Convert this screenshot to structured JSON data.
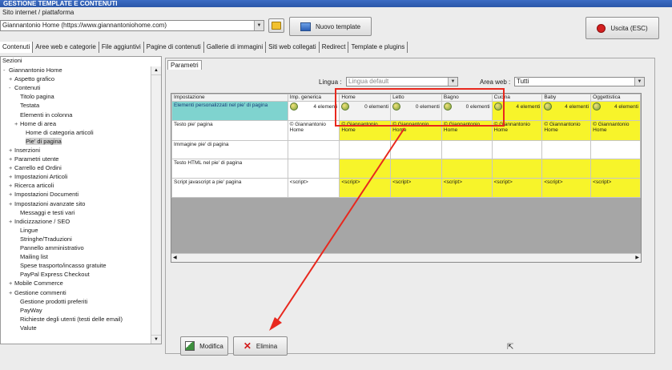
{
  "window": {
    "title": "GESTIONE TEMPLATE E CONTENUTI"
  },
  "site": {
    "label": "Sito internet / piattaforma",
    "selected": "Giannantonio Home (https://www.giannantoniohome.com)"
  },
  "buttons": {
    "new_template": "Nuovo template",
    "exit": "Uscita (ESC)",
    "modify": "Modifica",
    "delete": "Elimina"
  },
  "tabs": [
    "Contenuti",
    "Aree web e categorie",
    "File aggiuntivi",
    "Pagine di contenuti",
    "Gallerie di immagini",
    "Siti web collegati",
    "Redirect",
    "Template e plugins"
  ],
  "tree": {
    "header": "Sezioni",
    "items": [
      {
        "label": "Giannantonio Home",
        "exp": "-"
      },
      {
        "label": "Aspetto grafico",
        "exp": "+"
      },
      {
        "label": "Contenuti",
        "exp": "-"
      },
      {
        "label": "Titolo pagina",
        "exp": ""
      },
      {
        "label": "Testata",
        "exp": ""
      },
      {
        "label": "Elementi in colonna",
        "exp": ""
      },
      {
        "label": "Home di area",
        "exp": "+"
      },
      {
        "label": "Home di categoria articoli",
        "exp": ""
      },
      {
        "label": "Pie' di pagina",
        "exp": ""
      },
      {
        "label": "Inserzioni",
        "exp": "+"
      },
      {
        "label": "Parametri utente",
        "exp": "+"
      },
      {
        "label": "Carrello ed Ordini",
        "exp": "+"
      },
      {
        "label": "Impostazioni Articoli",
        "exp": "+"
      },
      {
        "label": "Ricerca articoli",
        "exp": "+"
      },
      {
        "label": "Impostazioni Documenti",
        "exp": "+"
      },
      {
        "label": "Impostazioni avanzate sito",
        "exp": "+"
      },
      {
        "label": "Messaggi e testi vari",
        "exp": ""
      },
      {
        "label": "Indicizzazione / SEO",
        "exp": "+"
      },
      {
        "label": "Lingue",
        "exp": ""
      },
      {
        "label": "Stringhe/Traduzioni",
        "exp": ""
      },
      {
        "label": "Pannello amministrativo",
        "exp": ""
      },
      {
        "label": "Mailing list",
        "exp": ""
      },
      {
        "label": "Spese trasporto/incasso gratuite",
        "exp": ""
      },
      {
        "label": "PayPal Express Checkout",
        "exp": ""
      },
      {
        "label": "Mobile Commerce",
        "exp": "+"
      },
      {
        "label": "Gestione commenti",
        "exp": "+"
      },
      {
        "label": "Gestione prodotti preferiti",
        "exp": ""
      },
      {
        "label": "PayWay",
        "exp": ""
      },
      {
        "label": "Richieste degli utenti (testi delle email)",
        "exp": ""
      },
      {
        "label": "Valute",
        "exp": ""
      }
    ]
  },
  "params": {
    "tab": "Parametri",
    "lingua_label": "Lingua :",
    "lingua_value": "Lingua default",
    "area_label": "Area web :",
    "area_value": "Tutti"
  },
  "grid": {
    "columns": [
      "Impostazione",
      "Imp. generica",
      "Home",
      "Letto",
      "Bagno",
      "Cucina",
      "Baby",
      "Oggettistica"
    ],
    "rows": [
      {
        "name": "Elementi personalizzati nel pie' di pagina",
        "cells": [
          "4 elementi",
          "0 elementi",
          "0 elementi",
          "0 elementi",
          "4 elementi",
          "4 elementi",
          "4 elementi"
        ]
      },
      {
        "name": "Testo pie' pagina",
        "cells": [
          "© Giannantonio Home",
          "© Giannantonio Home",
          "© Giannantonio Home",
          "© Giannantonio Home",
          "© Giannantonio Home",
          "© Giannantonio Home",
          "© Giannantonio Home"
        ]
      },
      {
        "name": "Immagine pie' di pagina",
        "cells": [
          "",
          "",
          "",
          "",
          "",
          "",
          ""
        ]
      },
      {
        "name": "Testo HTML nel pie' di pagina",
        "cells": [
          "",
          "",
          "",
          "",
          "",
          "",
          ""
        ]
      },
      {
        "name": "Script javascript a pie' pagina",
        "cells": [
          "<script>",
          "<script>",
          "<script>",
          "<script>",
          "<script>",
          "<script>",
          "<script>"
        ]
      }
    ]
  },
  "colors": {
    "highlight_cell": "#f7f42a",
    "selected_row": "#7fd3cf",
    "annotation": "#e8281e"
  }
}
